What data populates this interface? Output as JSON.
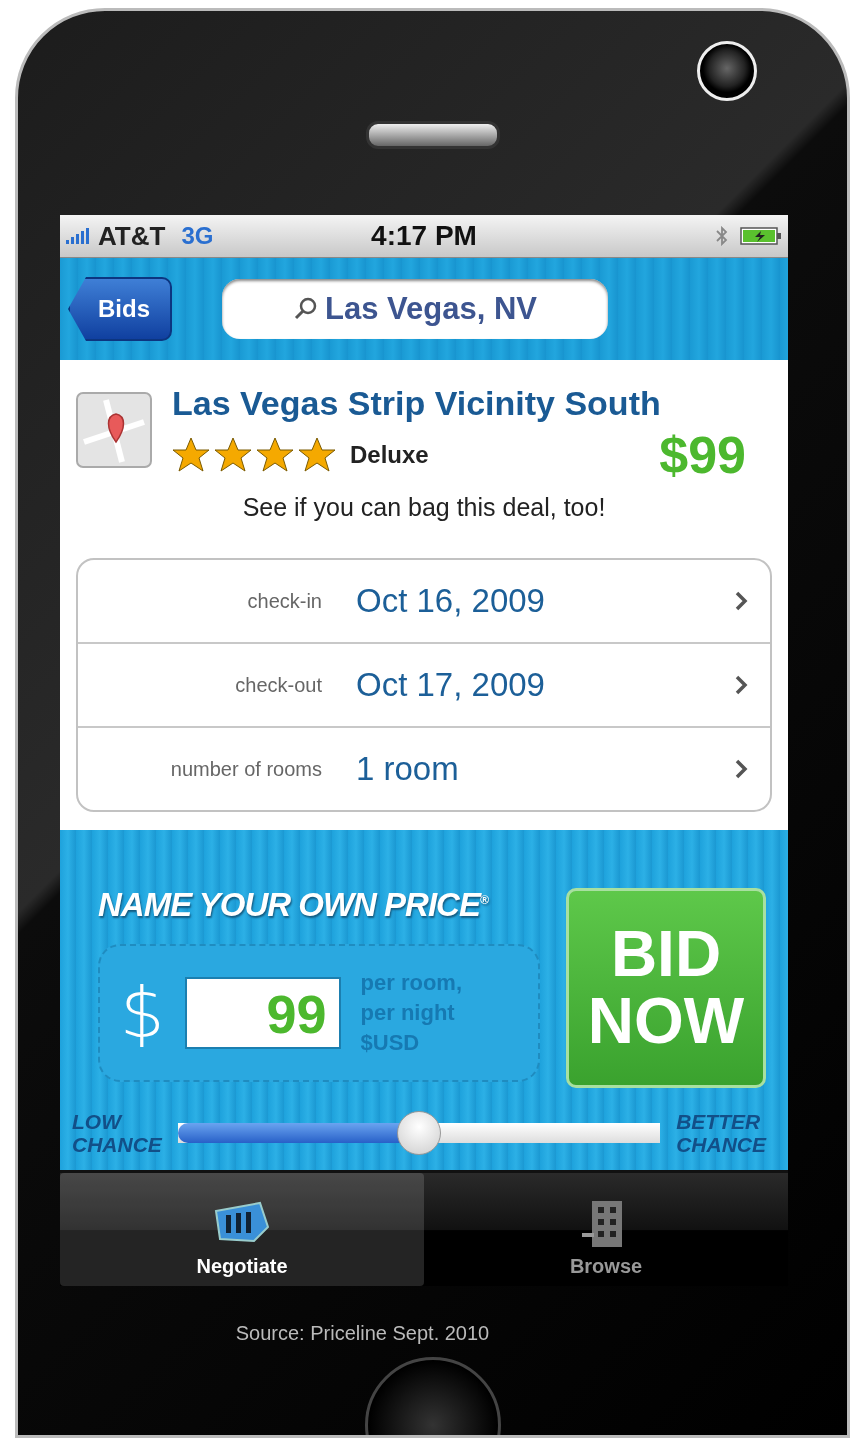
{
  "status_bar": {
    "carrier": "AT&T",
    "network": "3G",
    "time": "4:17 PM"
  },
  "nav": {
    "back_button": "Bids",
    "search": "Las Vegas, NV"
  },
  "hotel": {
    "name": "Las Vegas Strip Vicinity South",
    "stars": 4,
    "class": "Deluxe",
    "price": "$99",
    "tagline": "See if you can bag this deal, too!"
  },
  "details": [
    {
      "label": "check-in",
      "value": "Oct 16, 2009"
    },
    {
      "label": "check-out",
      "value": "Oct 17, 2009"
    },
    {
      "label": "number of rooms",
      "value": "1 room"
    }
  ],
  "bid": {
    "title": "NAME YOUR OWN PRICE$^{®}$",
    "currency": "$",
    "amount": "99",
    "unit_lines": [
      "per room,",
      "per night",
      "$USD"
    ],
    "button_lines": [
      "BID",
      "NOW"
    ],
    "slider": {
      "low_lines": [
        "LOW",
        "CHANCE"
      ],
      "high_lines": [
        "BETTER",
        "CHANCE"
      ],
      "level": 0.5
    }
  },
  "tabs": [
    {
      "label": "Negotiate",
      "selected": true
    },
    {
      "label": "Browse",
      "selected": false
    }
  ],
  "caption": "Source: Priceline Sept. 2010"
}
